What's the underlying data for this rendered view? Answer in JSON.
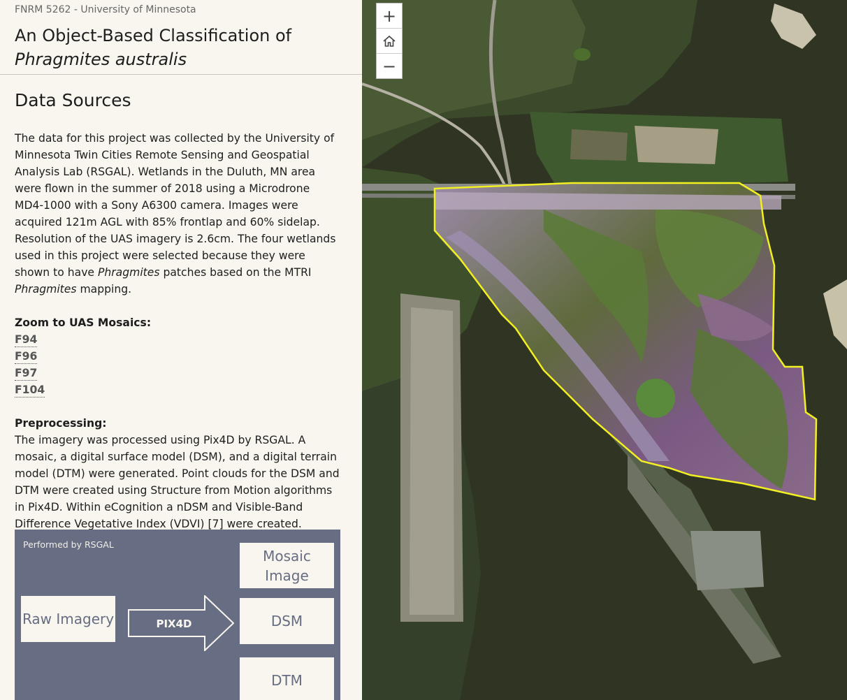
{
  "header": {
    "course": "FNRM 5262 - University of Minnesota",
    "title_line1": "An Object-Based Classification of",
    "title_line2": "Phragmites australis"
  },
  "section": {
    "heading": "Data Sources",
    "intro_part1": "The data for this project was collected by the University of Minnesota Twin Cities Remote Sensing and Geospatial Analysis Lab (RSGAL). Wetlands in the Duluth, MN area were flown in the summer of 2018 using a Microdrone MD4-1000 with a Sony A6300 camera. Images were acquired 121m AGL with 85% frontlap and 60% sidelap. Resolution of the UAS imagery is 2.6cm. The four wetlands used in this project were selected because they were shown to have ",
    "intro_italic1": "Phragmites",
    "intro_part2": " patches based on the MTRI ",
    "intro_italic2": "Phragmites",
    "intro_part3": " mapping.",
    "zoom_label": "Zoom to UAS Mosaics:",
    "zoom_links": [
      "F94",
      "F96",
      "F97",
      "F104"
    ],
    "preprocessing_label": "Preprocessing:",
    "preprocessing_text": "The imagery was processed using Pix4D by RSGAL. A mosaic, a digital surface model (DSM), and a digital terrain model (DTM) were generated. Point clouds for the DSM and DTM were created using Structure from Motion algorithms in Pix4D. Within eCognition a nDSM and Visible-Band Difference Vegetative Index (VDVI) [7] were created."
  },
  "diagram": {
    "caption": "Performed by RSGAL",
    "raw": "Raw Imagery",
    "arrow": "PIX4D",
    "mosaic": "Mosaic Image",
    "dsm": "DSM",
    "dtm": "DTM"
  },
  "map": {
    "zoom_in": "+",
    "home_icon": "home-icon",
    "zoom_out": "−",
    "boundary_color": "#f2ef22"
  }
}
